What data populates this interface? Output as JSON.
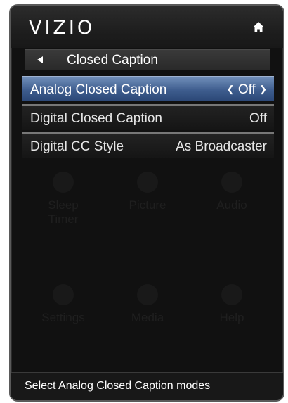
{
  "header": {
    "logo": "VIZIO",
    "home_icon": "home-icon"
  },
  "nav": {
    "back_icon": "back-arrow-icon",
    "title": "Closed Caption"
  },
  "menu": [
    {
      "label": "Analog Closed Caption",
      "value": "Off",
      "selected": true
    },
    {
      "label": "Digital Closed Caption",
      "value": "Off",
      "selected": false
    },
    {
      "label": "Digital CC Style",
      "value": "As Broadcaster",
      "selected": false
    }
  ],
  "background_menu": [
    {
      "label": "Sleep\nTimer",
      "icon": "clock-icon"
    },
    {
      "label": "Picture",
      "icon": "picture-icon"
    },
    {
      "label": "Audio",
      "icon": "audio-icon"
    },
    {
      "label": "Settings",
      "icon": "gear-icon"
    },
    {
      "label": "Media",
      "icon": "media-icon"
    },
    {
      "label": "Help",
      "icon": "help-icon"
    }
  ],
  "status": {
    "text": "Select Analog Closed Caption modes"
  },
  "colors": {
    "selected_row": "#3d5c8d",
    "background": "#111111",
    "text": "#ffffff"
  }
}
